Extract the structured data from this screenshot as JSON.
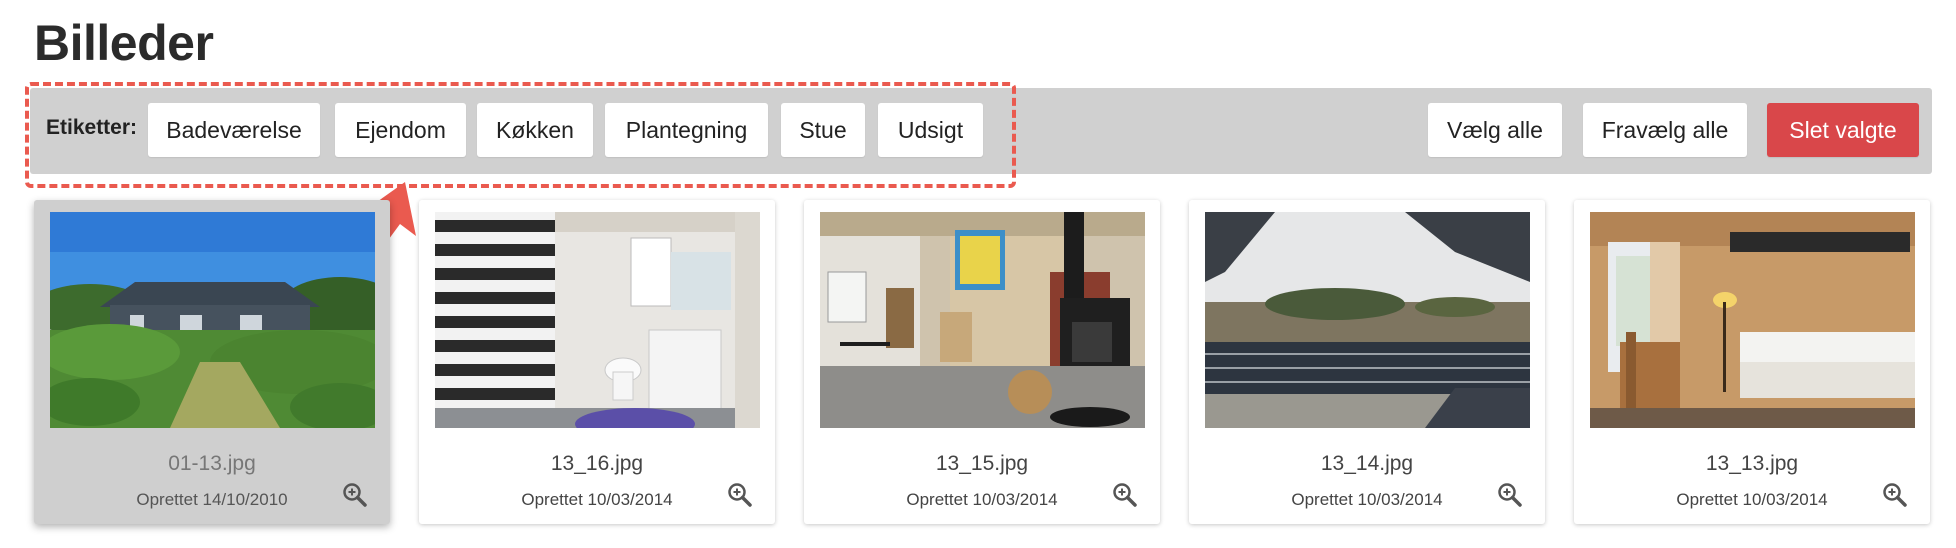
{
  "page": {
    "title": "Billeder"
  },
  "toolbar": {
    "tags_label": "Etiketter:",
    "tags": [
      "Badeværelse",
      "Ejendom",
      "Køkken",
      "Plantegning",
      "Stue",
      "Udsigt"
    ],
    "select_all": "Vælg alle",
    "deselect_all": "Fravælg alle",
    "delete_selected": "Slet valgte"
  },
  "images": [
    {
      "filename": "01-13.jpg",
      "created": "Oprettet 14/10/2010",
      "selected": true,
      "scene": "house-exterior"
    },
    {
      "filename": "13_16.jpg",
      "created": "Oprettet 10/03/2014",
      "selected": false,
      "scene": "bathroom"
    },
    {
      "filename": "13_15.jpg",
      "created": "Oprettet 10/03/2014",
      "selected": false,
      "scene": "living-room-stove"
    },
    {
      "filename": "13_14.jpg",
      "created": "Oprettet 10/03/2014",
      "selected": false,
      "scene": "terrace-dunes"
    },
    {
      "filename": "13_13.jpg",
      "created": "Oprettet 10/03/2014",
      "selected": false,
      "scene": "bedroom"
    }
  ],
  "icons": {
    "zoom": "zoom-in-icon",
    "annotation_arrow": "arrow-icon"
  },
  "colors": {
    "danger": "#d9474a",
    "annotation": "#ea5a4f",
    "toolbar": "#d0d0d0"
  }
}
